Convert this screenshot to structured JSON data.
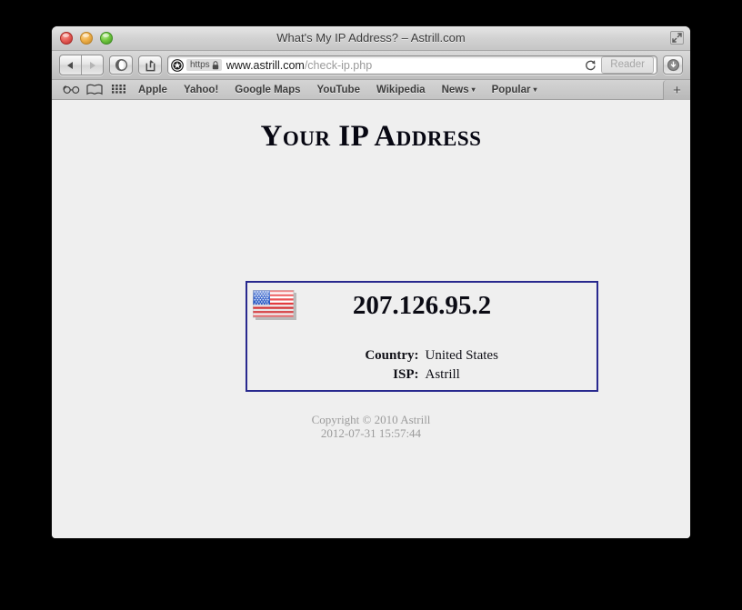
{
  "window": {
    "title": "What's My IP Address? – Astrill.com",
    "traffic_lights": [
      "close",
      "minimize",
      "zoom"
    ],
    "fullscreen_icon": "fullscreen-arrows-icon"
  },
  "toolbar": {
    "back_icon": "back-arrow-icon",
    "forward_icon": "forward-arrow-icon",
    "reading_list_icon": "reading-list-icon",
    "share_icon": "share-arrow-icon",
    "address": {
      "site_icon": "shield-star-icon",
      "scheme_label": "https",
      "lock_icon": "lock-icon",
      "host": "www.astrill.com",
      "path": "/check-ip.php"
    },
    "reload_icon": "reload-icon",
    "reader_label": "Reader",
    "downloads_icon": "downloads-icon"
  },
  "bookmarks_bar": {
    "icons": [
      {
        "name": "glasses-reading-list-icon"
      },
      {
        "name": "book-bookmarks-icon"
      },
      {
        "name": "grid-top-sites-icon"
      }
    ],
    "items": [
      {
        "label": "Apple",
        "has_menu": false
      },
      {
        "label": "Yahoo!",
        "has_menu": false
      },
      {
        "label": "Google Maps",
        "has_menu": false
      },
      {
        "label": "YouTube",
        "has_menu": false
      },
      {
        "label": "Wikipedia",
        "has_menu": false
      },
      {
        "label": "News",
        "has_menu": true
      },
      {
        "label": "Popular",
        "has_menu": true
      }
    ],
    "caret": "▾",
    "new_tab_label": "+"
  },
  "page": {
    "heading": "Your IP Address",
    "ip_address": "207.126.95.2",
    "flag_icon": "us-flag-icon",
    "details": [
      {
        "label": "Country:",
        "value": "United States"
      },
      {
        "label": "ISP:",
        "value": "Astrill"
      }
    ],
    "copyright": "Copyright © 2010 Astrill",
    "timestamp": "2012-07-31 15:57:44",
    "colors": {
      "box_border": "#28298e",
      "background": "#efefef",
      "footer_text": "#9b9b9b"
    }
  }
}
